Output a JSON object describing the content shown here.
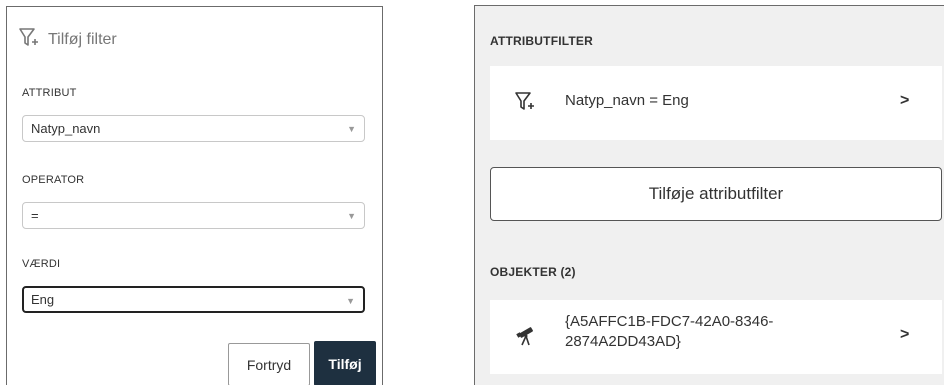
{
  "left": {
    "header_title": "Tilføj filter",
    "attribute_label": "ATTRIBUT",
    "attribute_value": "Natyp_navn",
    "operator_label": "OPERATOR",
    "operator_value": "=",
    "value_label": "VÆRDI",
    "value_value": "Eng",
    "cancel_label": "Fortryd",
    "add_label": "Tilføj",
    "dropdown_arrow": "▼"
  },
  "right": {
    "attribute_filter_title": "ATTRIBUTFILTER",
    "active_filter_text": "Natyp_navn = Eng",
    "add_filter_label": "Tilføje attributfilter",
    "objects_title": "OBJEKTER (2)",
    "object_id": "{A5AFFC1B-FDC7-42A0-8346-2874A2DD43AD}",
    "chevron": ">"
  },
  "colors": {
    "primary_button": "#1e3040",
    "panel_bg": "#f0f0f0",
    "border": "#6b6b6b"
  },
  "icons": [
    "filter-add-icon",
    "dropdown-arrow-icon",
    "chevron-right-icon",
    "telescope-icon"
  ]
}
